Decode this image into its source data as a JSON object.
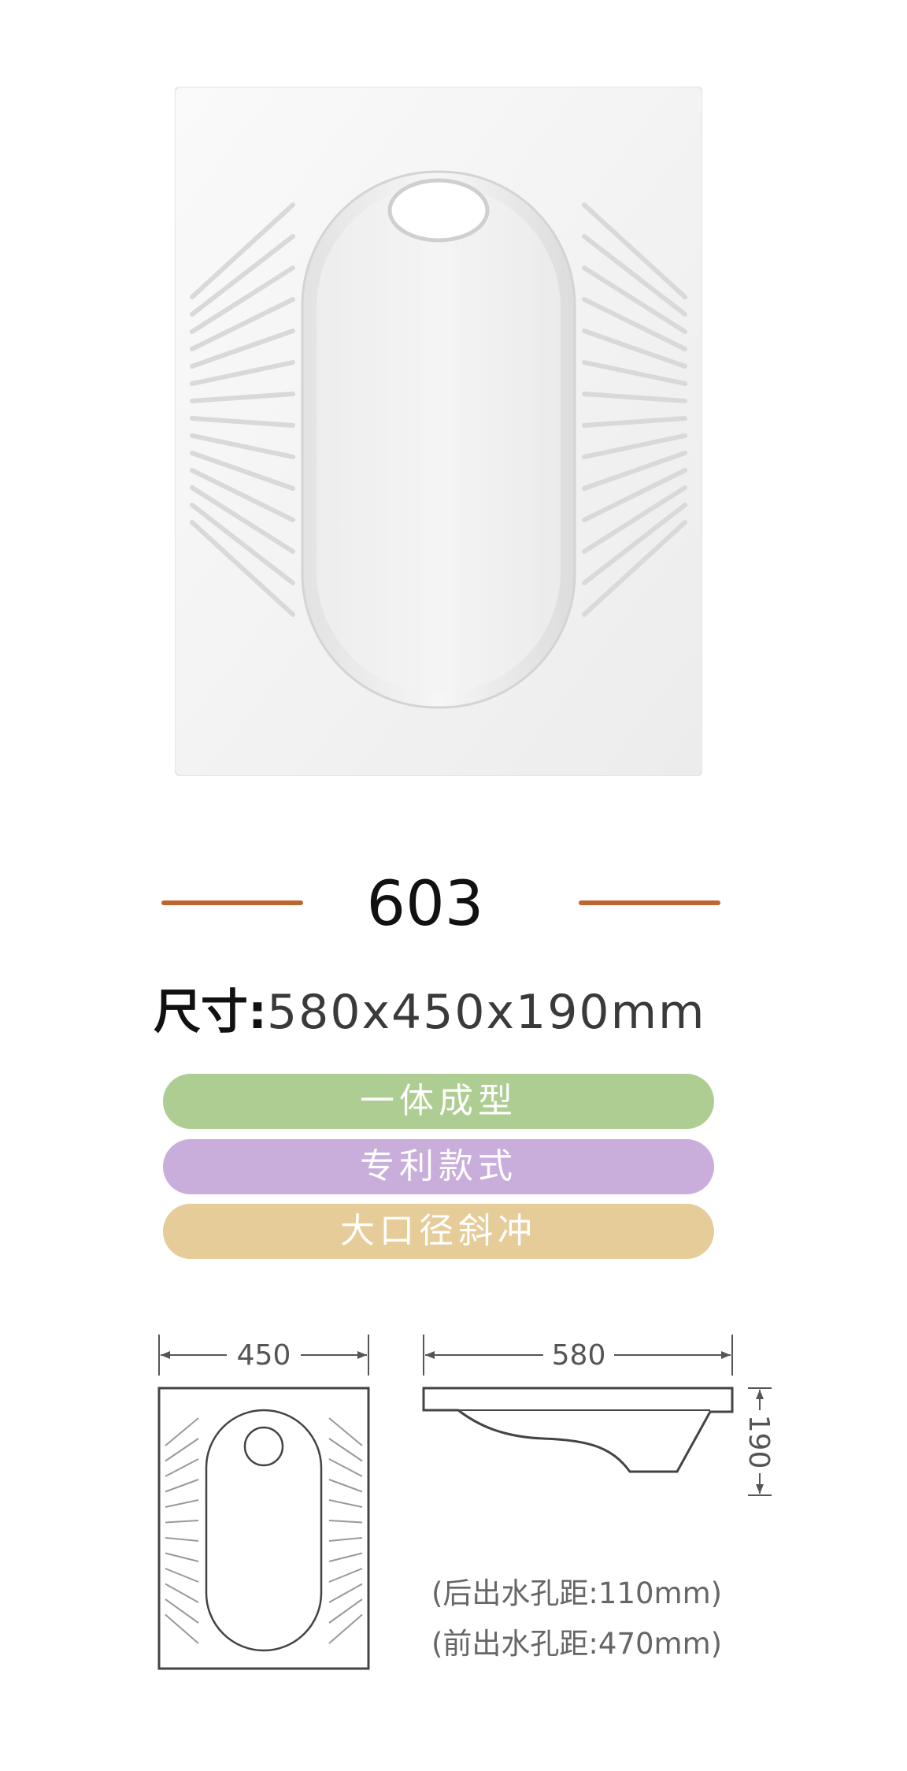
{
  "product": {
    "model": "603",
    "size_label": "尺寸:",
    "size_value": "580x450x190mm"
  },
  "features": [
    {
      "label": "一体成型",
      "color": "#aecd92"
    },
    {
      "label": "专利款式",
      "color": "#c9aedc"
    },
    {
      "label": "大口径斜冲",
      "color": "#e6cc98"
    }
  ],
  "colors": {
    "accent_rule": "#c0652e"
  },
  "drawing": {
    "top_view_width": "450",
    "side_view_length": "580",
    "side_view_height": "190"
  },
  "notes": [
    "(后出水孔距:110mm)",
    "(前出水孔距:470mm)"
  ]
}
